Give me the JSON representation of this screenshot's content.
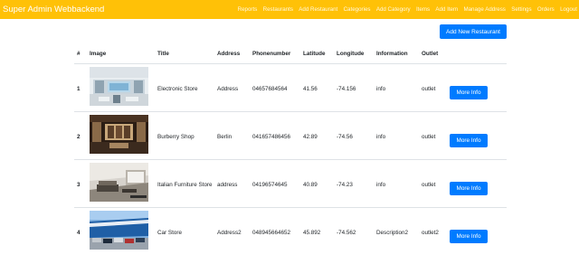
{
  "navbar": {
    "brand": "Super Admin Webbackend",
    "links": [
      "Reports",
      "Restaurants",
      "Add Restaurant",
      "Categories",
      "Add Category",
      "Items",
      "Add Item",
      "Manage Address",
      "Settings",
      "Orders",
      "Logout"
    ]
  },
  "toolbar": {
    "add_button_label": "Add New Restaurant"
  },
  "table": {
    "columns": [
      "#",
      "Image",
      "Title",
      "Address",
      "Phonenumber",
      "Latitude",
      "Longitude",
      "Information",
      "Outlet",
      ""
    ],
    "rows": [
      {
        "index": "1",
        "image": "electronic-store-photo",
        "title": "Electronic Store",
        "address": "Address",
        "phone": "04657684564",
        "latitude": "41.56",
        "longitude": "-74.156",
        "information": "info",
        "outlet": "outlet",
        "button": "More Info"
      },
      {
        "index": "2",
        "image": "burberry-shop-photo",
        "title": "Burberry Shop",
        "address": "Berlin",
        "phone": "041657486456",
        "latitude": "42.89",
        "longitude": "-74.56",
        "information": "info",
        "outlet": "outlet",
        "button": "More Info"
      },
      {
        "index": "3",
        "image": "furniture-store-photo",
        "title": "Italian Furniture Store",
        "address": "address",
        "phone": "04196574645",
        "latitude": "40.89",
        "longitude": "-74.23",
        "information": "info",
        "outlet": "outlet",
        "button": "More Info"
      },
      {
        "index": "4",
        "image": "car-store-photo",
        "title": "Car Store",
        "address": "Address2",
        "phone": "048945664652",
        "latitude": "45.892",
        "longitude": "-74.562",
        "information": "Description2",
        "outlet": "outlet2",
        "button": "More Info"
      }
    ]
  },
  "colors": {
    "navbar": "#ffc107",
    "primary": "#007bff",
    "border": "#dee2e6"
  }
}
